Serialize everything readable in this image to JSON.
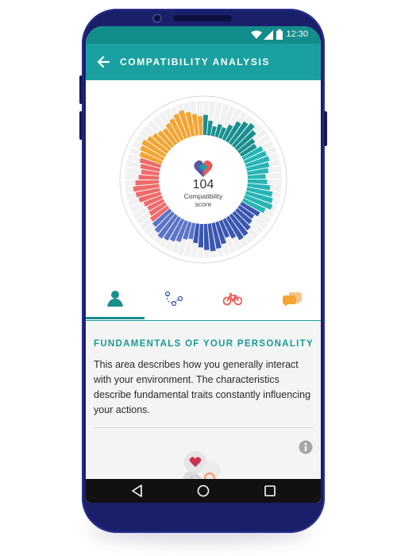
{
  "status_bar": {
    "time": "12:30"
  },
  "app_bar": {
    "title": "COMPATIBILITY ANALYSIS"
  },
  "chart_data": {
    "type": "radial-bar",
    "center_value": "104",
    "center_label_line1": "Compatibility",
    "center_label_line2": "score",
    "colors": [
      "#1a8f8f",
      "#26b5b5",
      "#3a57b0",
      "#5b74c8",
      "#ef6b6b",
      "#f3a533"
    ],
    "values": [
      0.62,
      0.45,
      0.3,
      0.4,
      0.35,
      0.5,
      0.7,
      0.82,
      0.9,
      0.78,
      0.6,
      0.55,
      0.68,
      0.72,
      0.75,
      0.7,
      0.65,
      0.55,
      0.6,
      0.7,
      0.8,
      0.85,
      0.9,
      0.75,
      0.65,
      0.55,
      0.6,
      0.7,
      0.78,
      0.8,
      0.65,
      0.55,
      0.7,
      0.8,
      0.85,
      0.8,
      0.72,
      0.6,
      0.5,
      0.55,
      0.68,
      0.74,
      0.8,
      0.85,
      0.78,
      0.7,
      0.65,
      0.58,
      0.55,
      0.6,
      0.7,
      0.75,
      0.8,
      0.72,
      0.62,
      0.55,
      0.6,
      0.66,
      0.72,
      0.78,
      0.82,
      0.75,
      0.68,
      0.62,
      0.58,
      0.66,
      0.72,
      0.8,
      0.85,
      0.75,
      0.66,
      0.58
    ],
    "color_bands": [
      [
        0,
        12,
        0
      ],
      [
        12,
        24,
        1
      ],
      [
        24,
        38,
        2
      ],
      [
        38,
        46,
        3
      ],
      [
        46,
        58,
        4
      ],
      [
        58,
        72,
        5
      ]
    ]
  },
  "tabs": [
    {
      "name": "personality",
      "icon": "person-icon",
      "color": "#1a8d8d"
    },
    {
      "name": "relationships",
      "icon": "connection-icon",
      "color": "#3a57b0"
    },
    {
      "name": "activities",
      "icon": "bicycle-icon",
      "color": "#ef5a5a"
    },
    {
      "name": "communication",
      "icon": "chat-bubbles-icon",
      "color": "#f3a533"
    }
  ],
  "section": {
    "title": "FUNDAMENTALS OF YOUR PERSONALITY",
    "text": "This area describes how you generally interact with your environment. The characteristics describe fundamental traits constantly influencing your actions."
  }
}
